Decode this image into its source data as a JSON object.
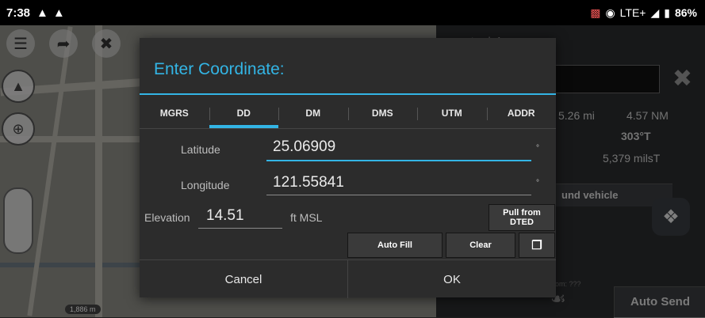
{
  "status_bar": {
    "time": "7:38",
    "network": "LTE+",
    "battery": "86%"
  },
  "background": {
    "panel_title": "truck 1",
    "distance_mi": "5.26 mi",
    "distance_nm": "4.57 NM",
    "bearing": "303°T",
    "mils": "5,379 milsT",
    "vehicle_label": "und vehicle",
    "auto_send": "Auto Send",
    "faint_text": "om: ???",
    "scale": "1,886 m"
  },
  "dialog": {
    "title": "Enter Coordinate:",
    "tabs": [
      {
        "label": "MGRS",
        "active": false
      },
      {
        "label": "DD",
        "active": true
      },
      {
        "label": "DM",
        "active": false
      },
      {
        "label": "DMS",
        "active": false
      },
      {
        "label": "UTM",
        "active": false
      },
      {
        "label": "ADDR",
        "active": false
      }
    ],
    "latitude": {
      "label": "Latitude",
      "value": "25.06909",
      "unit": "°"
    },
    "longitude": {
      "label": "Longitude",
      "value": "121.55841",
      "unit": "°"
    },
    "elevation": {
      "label": "Elevation",
      "value": "14.51",
      "unit": "ft MSL"
    },
    "pull_dted": "Pull from DTED",
    "auto_fill": "Auto Fill",
    "clear": "Clear",
    "cancel": "Cancel",
    "ok": "OK"
  }
}
